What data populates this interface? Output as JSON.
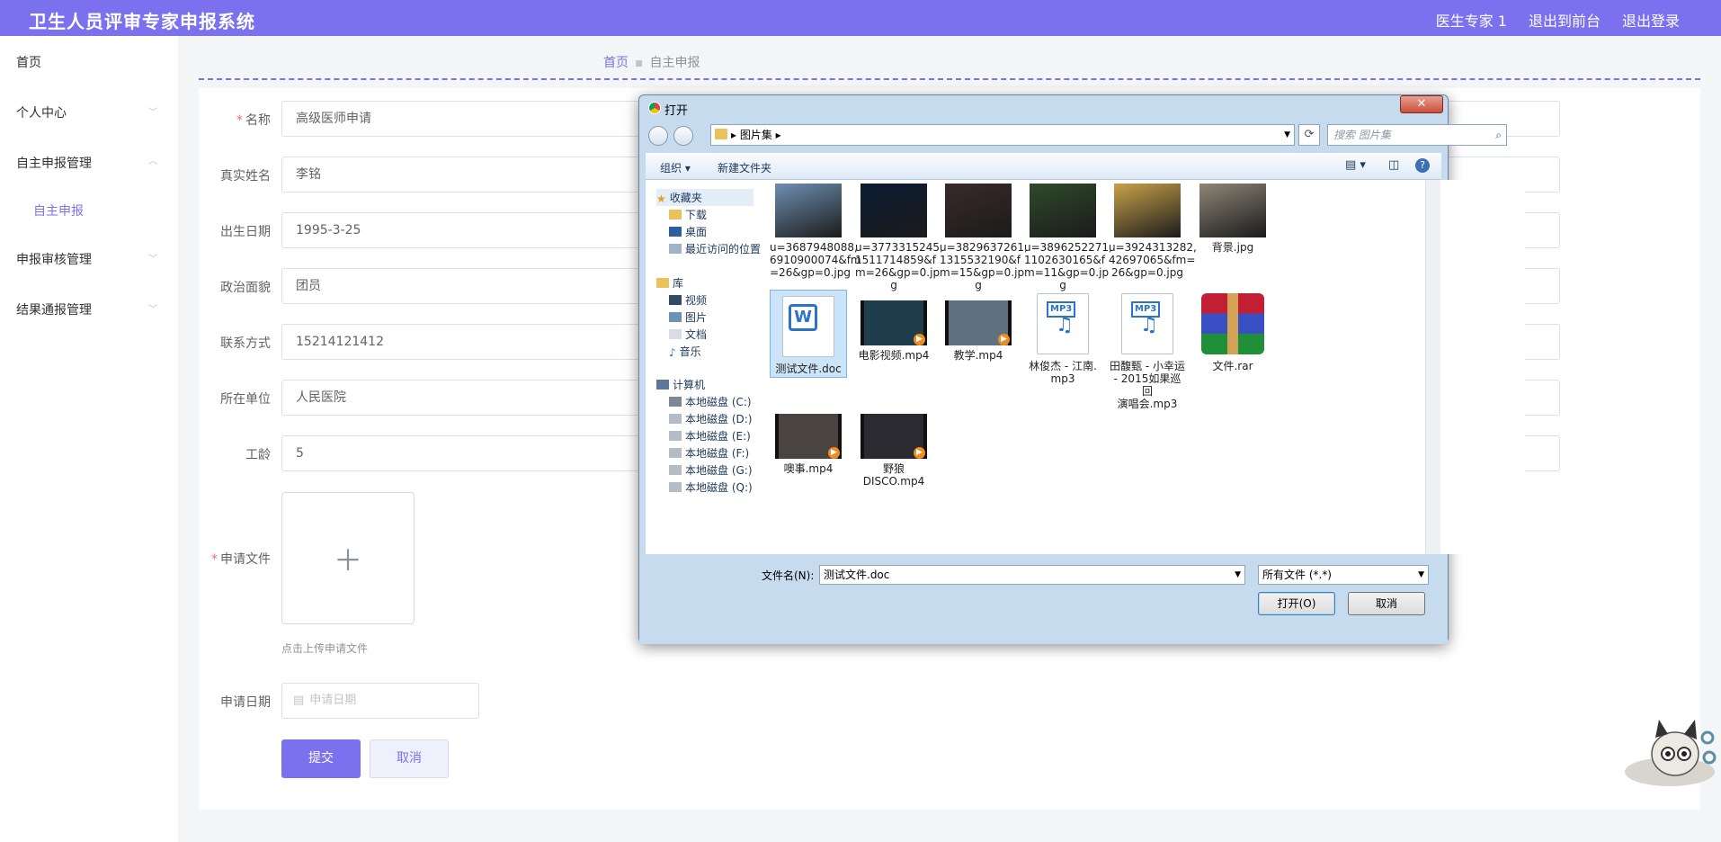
{
  "app": {
    "title": "卫生人员评审专家申报系统",
    "user": "医生专家 1",
    "to_front": "退出到前台",
    "logout": "退出登录",
    "accent": "#7b71ee"
  },
  "sidebar": {
    "items": [
      {
        "label": "首页"
      },
      {
        "label": "个人中心"
      },
      {
        "label": "自主申报管理"
      },
      {
        "label": "申报审核管理"
      },
      {
        "label": "结果通报管理"
      }
    ],
    "sub_item": "自主申报"
  },
  "breadcrumb": {
    "home": "首页",
    "current": "自主申报"
  },
  "form": {
    "name_label": "名称",
    "name_value": "高级医师申请",
    "realname_label": "真实姓名",
    "realname_value": "李铭",
    "birth_label": "出生日期",
    "birth_value": "1995-3-25",
    "politics_label": "政治面貌",
    "politics_value": "团员",
    "phone_label": "联系方式",
    "phone_value": "15214121412",
    "unit_label": "所在单位",
    "unit_value": "人民医院",
    "years_label": "工龄",
    "years_value": "5",
    "file_label": "申请文件",
    "upload_hint": "点击上传申请文件",
    "date_label": "申请日期",
    "date_placeholder": "申请日期",
    "submit": "提交",
    "cancel": "取消"
  },
  "dialog": {
    "title": "打开",
    "close": "✕",
    "path": "图片集",
    "search_placeholder": "搜索 图片集",
    "organize": "组织",
    "new_folder": "新建文件夹",
    "nav": {
      "favorites": "收藏夹",
      "downloads": "下载",
      "desktop": "桌面",
      "recent": "最近访问的位置",
      "libraries": "库",
      "videos": "视频",
      "pictures": "图片",
      "documents": "文档",
      "music": "音乐",
      "computer": "计算机",
      "drives": [
        "本地磁盘 (C:)",
        "本地磁盘 (D:)",
        "本地磁盘 (E:)",
        "本地磁盘 (F:)",
        "本地磁盘 (G:)",
        "本地磁盘 (Q:)"
      ]
    },
    "files": [
      {
        "name": "u=3687948088,\n6910900074&fm\n=26&gp=0.jpg",
        "kind": "photo",
        "color": "#6e8fb2"
      },
      {
        "name": "u=3773315245,\n1511714859&f\nm=26&gp=0.jp\ng",
        "kind": "photo",
        "color": "#0b1b33"
      },
      {
        "name": "u=3829637261,\n1315532190&f\nm=15&gp=0.jp\ng",
        "kind": "photo",
        "color": "#3a2a2a"
      },
      {
        "name": "u=3896252271,\n1102630165&f\nm=11&gp=0.jp\ng",
        "kind": "photo",
        "color": "#2f4a2a"
      },
      {
        "name": "u=3924313282,\n42697065&fm=\n26&gp=0.jpg",
        "kind": "photo",
        "color": "#c9a14a"
      },
      {
        "name": "背景.jpg",
        "kind": "photo",
        "color": "#8e8577"
      },
      {
        "name": "测试文件.doc",
        "kind": "doc",
        "color": "#2b73c8"
      },
      {
        "name": "电影视频.mp4",
        "kind": "video",
        "color": "#1f3d4a"
      },
      {
        "name": "教学.mp4",
        "kind": "video",
        "color": "#5f7180"
      },
      {
        "name": "林俊杰 - 江南.\nmp3",
        "kind": "mp3",
        "color": "#2b73c8"
      },
      {
        "name": "田馥甄 - 小幸运\n- 2015如果巡回\n演唱会.mp3",
        "kind": "mp3",
        "color": "#2b73c8"
      },
      {
        "name": "文件.rar",
        "kind": "rar",
        "color": "#b01c2c"
      },
      {
        "name": "噢事.mp4",
        "kind": "video",
        "color": "#4a4440"
      },
      {
        "name": "野狼DISCO.mp4",
        "kind": "video",
        "color": "#2a2a30"
      }
    ],
    "filename_label": "文件名(N):",
    "filename_value": "测试文件.doc",
    "filter": "所有文件 (*.*)",
    "open": "打开(O)",
    "cancel": "取消"
  }
}
